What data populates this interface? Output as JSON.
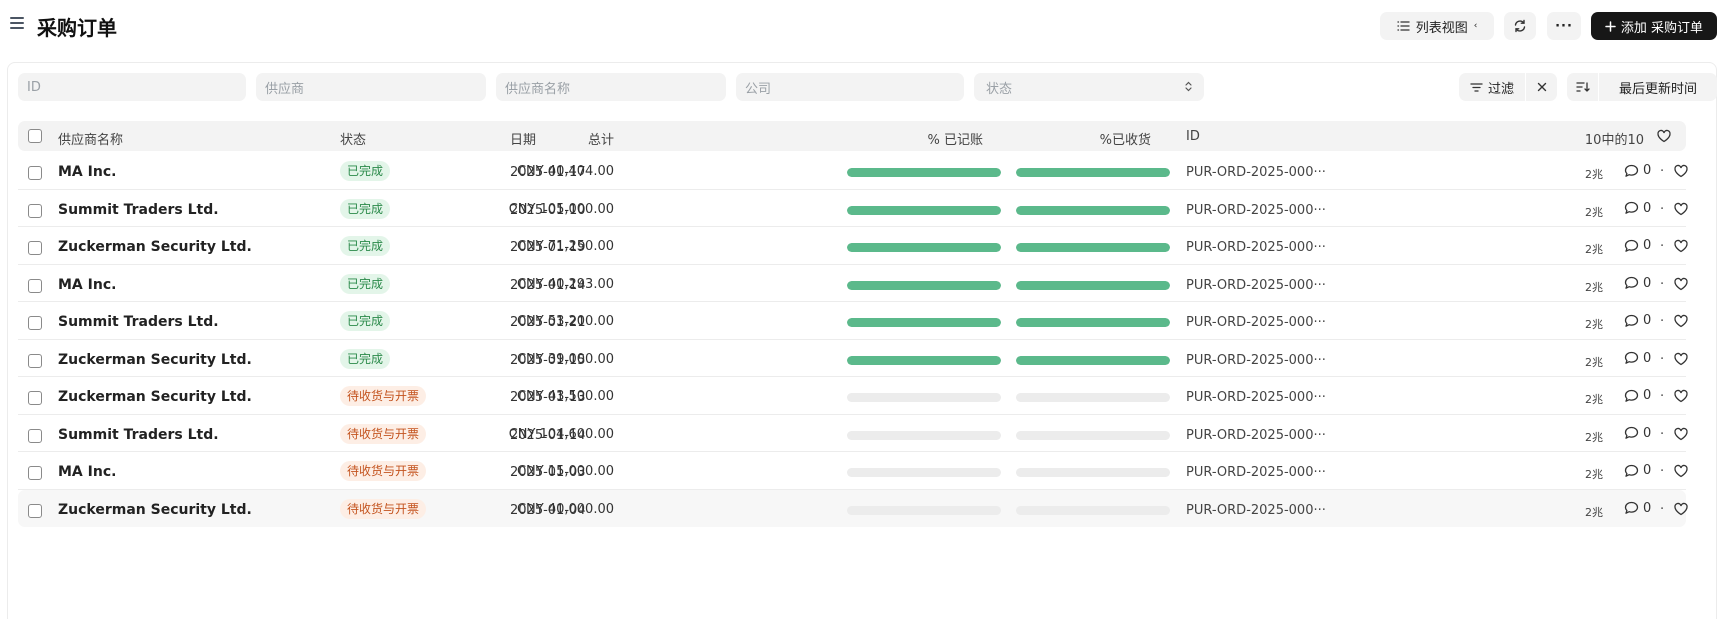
{
  "header": {
    "title": "采购订单",
    "view_label": "列表视图",
    "more_label": "···",
    "add_label": "添加 采购订单"
  },
  "filters": {
    "id_placeholder": "ID",
    "supplier_placeholder": "供应商",
    "supplier_name_placeholder": "供应商名称",
    "company_placeholder": "公司",
    "status_placeholder": "状态",
    "filter_label": "过滤",
    "sort_label": "最后更新时间"
  },
  "table": {
    "columns": {
      "supplier_name": "供应商名称",
      "status": "状态",
      "date": "日期",
      "total": "总计",
      "billed": "% 已记账",
      "received": "%已收货",
      "id": "ID",
      "count": "10中的10"
    },
    "rows": [
      {
        "supplier": "MA Inc.",
        "status": "已完成",
        "status_type": "done",
        "date": "2025-01-17",
        "total": "CNY 40,404.00",
        "billed_pct": 100,
        "received_pct": 100,
        "id": "PUR-ORD-2025-000···",
        "ago": "2兆",
        "comments": "0"
      },
      {
        "supplier": "Summit Traders Ltd.",
        "status": "已完成",
        "status_type": "done",
        "date": "2025-01-10",
        "total": "CNY 105,000.00",
        "billed_pct": 100,
        "received_pct": 100,
        "id": "PUR-ORD-2025-000···",
        "ago": "2兆",
        "comments": "0"
      },
      {
        "supplier": "Zuckerman Security Ltd.",
        "status": "已完成",
        "status_type": "done",
        "date": "2025-01-19",
        "total": "CNY 71,250.00",
        "billed_pct": 100,
        "received_pct": 100,
        "id": "PUR-ORD-2025-000···",
        "ago": "2兆",
        "comments": "0"
      },
      {
        "supplier": "MA Inc.",
        "status": "已完成",
        "status_type": "done",
        "date": "2025-01-14",
        "total": "CNY 40,293.00",
        "billed_pct": 100,
        "received_pct": 100,
        "id": "PUR-ORD-2025-000···",
        "ago": "2兆",
        "comments": "0"
      },
      {
        "supplier": "Summit Traders Ltd.",
        "status": "已完成",
        "status_type": "done",
        "date": "2025-01-21",
        "total": "CNY 53,200.00",
        "billed_pct": 100,
        "received_pct": 100,
        "id": "PUR-ORD-2025-000···",
        "ago": "2兆",
        "comments": "0"
      },
      {
        "supplier": "Zuckerman Security Ltd.",
        "status": "已完成",
        "status_type": "done",
        "date": "2025-01-15",
        "total": "CNY 39,000.00",
        "billed_pct": 100,
        "received_pct": 100,
        "id": "PUR-ORD-2025-000···",
        "ago": "2兆",
        "comments": "0"
      },
      {
        "supplier": "Zuckerman Security Ltd.",
        "status": "待收货与开票",
        "status_type": "pending",
        "date": "2025-01-13",
        "total": "CNY 43,500.00",
        "billed_pct": 0,
        "received_pct": 0,
        "id": "PUR-ORD-2025-000···",
        "ago": "2兆",
        "comments": "0"
      },
      {
        "supplier": "Summit Traders Ltd.",
        "status": "待收货与开票",
        "status_type": "pending",
        "date": "2025-01-14",
        "total": "CNY 104,600.00",
        "billed_pct": 0,
        "received_pct": 0,
        "id": "PUR-ORD-2025-000···",
        "ago": "2兆",
        "comments": "0"
      },
      {
        "supplier": "MA Inc.",
        "status": "待收货与开票",
        "status_type": "pending",
        "date": "2025-01-03",
        "total": "CNY 15,000.00",
        "billed_pct": 0,
        "received_pct": 0,
        "id": "PUR-ORD-2025-000···",
        "ago": "2兆",
        "comments": "0"
      },
      {
        "supplier": "Zuckerman Security Ltd.",
        "status": "待收货与开票",
        "status_type": "pending",
        "date": "2025-01-04",
        "total": "CNY 40,000.00",
        "billed_pct": 0,
        "received_pct": 0,
        "id": "PUR-ORD-2025-000···",
        "ago": "2兆",
        "comments": "0"
      }
    ]
  },
  "icons": {
    "menu": "hamburger-icon",
    "view": "list-icon",
    "refresh": "refresh-icon",
    "add": "plus-icon",
    "filter": "filter-icon",
    "clear": "close-icon",
    "sort": "sort-icon",
    "comment": "comment-icon",
    "like": "heart-icon"
  },
  "colors": {
    "progress": "#5bb98b",
    "done_badge_text": "#2b8a4a",
    "pending_badge_text": "#c4541f",
    "primary_button": "#171717"
  }
}
